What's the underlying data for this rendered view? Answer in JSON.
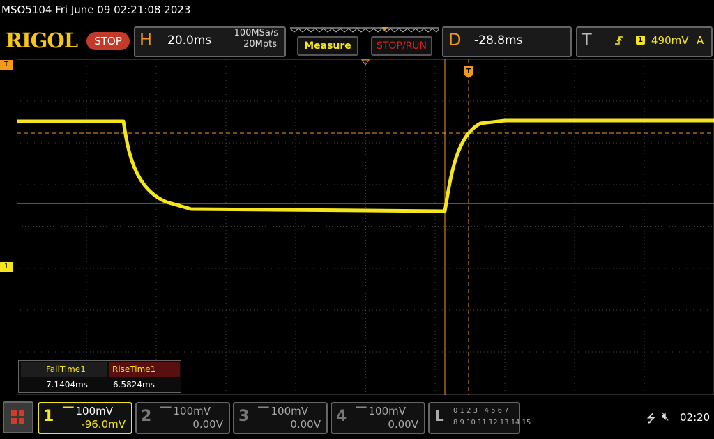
{
  "title_line": "MSO5104  Fri June 09 02:21:08 2023",
  "brand": "RIGOL",
  "run_state": "STOP",
  "horizontal": {
    "letter": "H",
    "timebase": "20.0ms",
    "sample_rate": "100MSa/s",
    "memory_depth": "20Mpts"
  },
  "buttons": {
    "measure": "Measure",
    "stop_run": "STOP/RUN"
  },
  "delay": {
    "letter": "D",
    "value": "-28.8ms"
  },
  "trigger": {
    "letter": "T",
    "channel": "1",
    "level": "490mV",
    "mode": "A",
    "left_marker": "T"
  },
  "ch1_ground_marker": "1",
  "measurements": {
    "fall_label": "FallTime1",
    "fall_value": "7.1404ms",
    "rise_label": "RiseTime1",
    "rise_value": "6.5824ms"
  },
  "channels": [
    {
      "num": "1",
      "scale": "100mV",
      "offset": "-96.0mV",
      "active": true
    },
    {
      "num": "2",
      "scale": "100mV",
      "offset": "0.00V",
      "active": false
    },
    {
      "num": "3",
      "scale": "100mV",
      "offset": "0.00V",
      "active": false
    },
    {
      "num": "4",
      "scale": "100mV",
      "offset": "0.00V",
      "active": false
    }
  ],
  "logic": {
    "letter": "L",
    "row1": "0 1 2 3   4 5 6 7",
    "row2": "8 9 10 11 12 13 14 15"
  },
  "clock": "02:20",
  "colors": {
    "ch1": "#f5e61c",
    "cursor": "#f39a1b",
    "stop": "#c43a2a"
  },
  "icons": {
    "usb": "usb-icon",
    "speaker": "speaker-muted-icon",
    "menu": "grid-menu-icon"
  }
}
